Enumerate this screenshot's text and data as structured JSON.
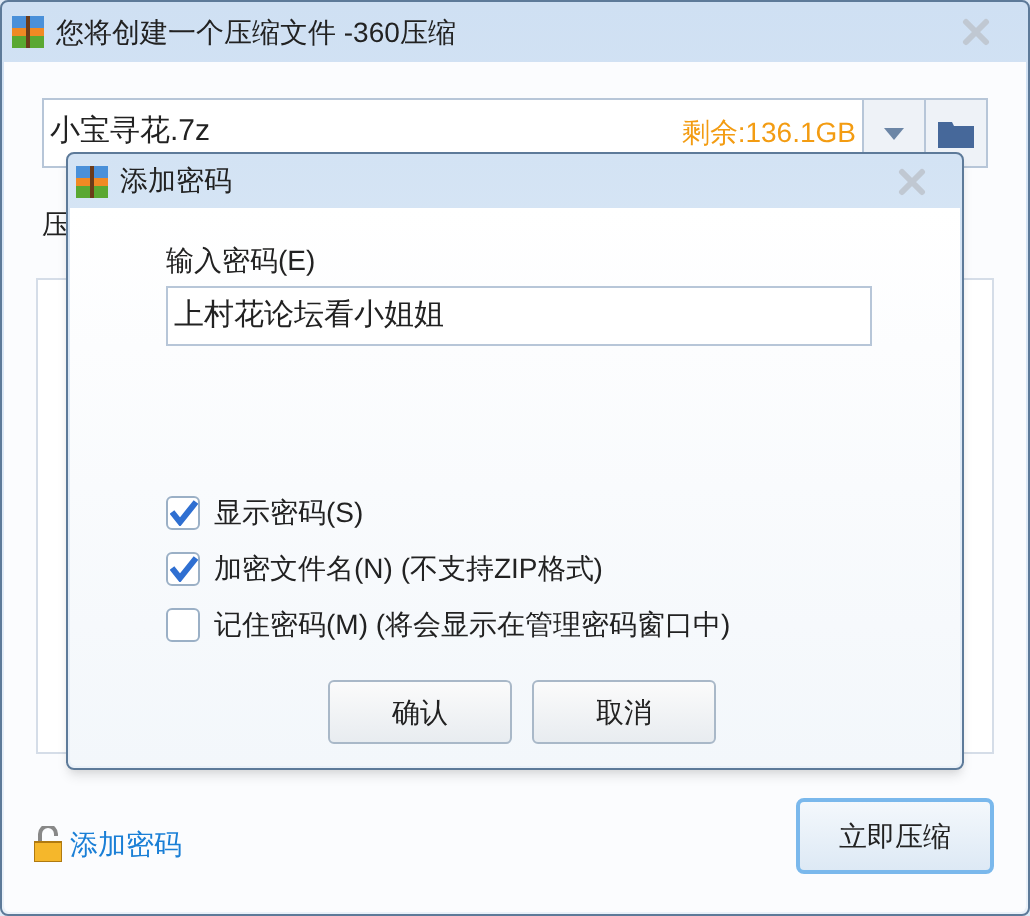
{
  "window": {
    "title": "您将创建一个压缩文件 -360压缩"
  },
  "file_field": {
    "value": "小宝寻花.7z",
    "free_space": "剩余:136.1GB"
  },
  "partial_label": "压",
  "add_password_link": "添加密码",
  "compress_button": "立即压缩",
  "dialog": {
    "title": "添加密码",
    "password_label": "输入密码(E)",
    "password_value": "上村花论坛看小姐姐",
    "options": [
      {
        "label": "显示密码(S)",
        "checked": true
      },
      {
        "label": "加密文件名(N) (不支持ZIP格式)",
        "checked": true
      },
      {
        "label": "记住密码(M) (将会显示在管理密码窗口中)",
        "checked": false
      }
    ],
    "buttons": [
      "确认",
      "取消"
    ]
  }
}
